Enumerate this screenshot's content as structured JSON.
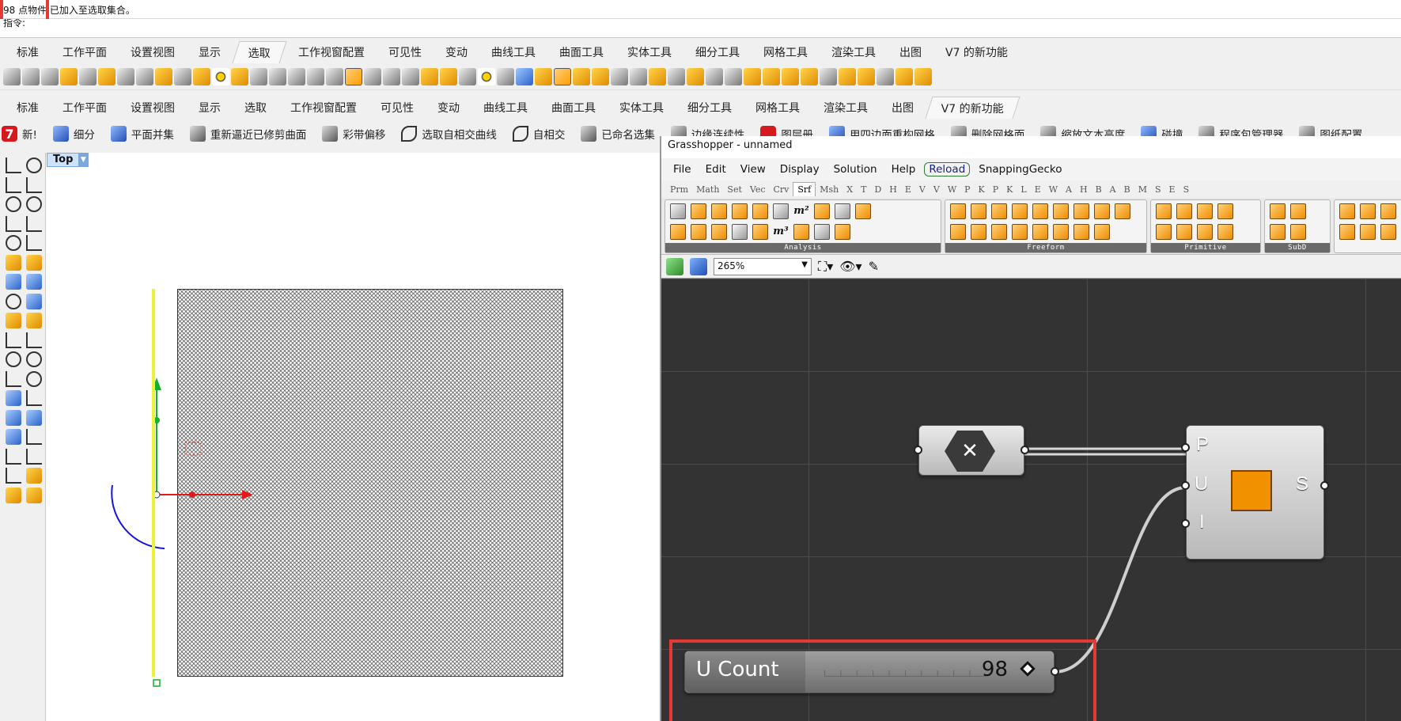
{
  "command": {
    "history_text": "98 点物件 已加入至选取集合。",
    "prompt_text": "指令:"
  },
  "tabs_top": [
    "标准",
    "工作平面",
    "设置视图",
    "显示",
    "选取",
    "工作视窗配置",
    "可见性",
    "变动",
    "曲线工具",
    "曲面工具",
    "实体工具",
    "细分工具",
    "网格工具",
    "渲染工具",
    "出图",
    "V7 的新功能"
  ],
  "tabs_top_active": "选取",
  "tabs_second": [
    "标准",
    "工作平面",
    "设置视图",
    "显示",
    "选取",
    "工作视窗配置",
    "可见性",
    "变动",
    "曲线工具",
    "曲面工具",
    "实体工具",
    "细分工具",
    "网格工具",
    "渲染工具",
    "出图",
    "V7 的新功能"
  ],
  "tabs_second_active": "V7 的新功能",
  "tools": [
    {
      "label": "新!",
      "icon": "new-badge-icon",
      "style": "red"
    },
    {
      "label": "细分",
      "icon": "subd-icon",
      "style": "blue"
    },
    {
      "label": "平面并集",
      "icon": "planar-union-icon",
      "style": "blue"
    },
    {
      "label": "重新逼近已修剪曲面",
      "icon": "refit-trim-icon",
      "style": "grey"
    },
    {
      "label": "彩带偏移",
      "icon": "ribbon-offset-icon",
      "style": "grey"
    },
    {
      "label": "选取自相交曲线",
      "icon": "self-intersect-curve-icon",
      "style": "line"
    },
    {
      "label": "自相交",
      "icon": "self-intersect-icon",
      "style": "line"
    },
    {
      "label": "已命名选集",
      "icon": "named-selection-icon",
      "style": "grey"
    },
    {
      "label": "边缘连续性",
      "icon": "edge-continuity-icon",
      "style": "grey"
    },
    {
      "label": "图层册",
      "icon": "layer-book-icon",
      "style": "red"
    },
    {
      "label": "用四边面重构网格",
      "icon": "quad-remesh-icon",
      "style": "blue"
    },
    {
      "label": "删除网格面",
      "icon": "delete-mesh-faces-icon",
      "style": "grey"
    },
    {
      "label": "缩放文本高度",
      "icon": "scale-text-icon",
      "style": "grey"
    },
    {
      "label": "碰撞",
      "icon": "collision-icon",
      "style": "blue"
    },
    {
      "label": "程序包管理器",
      "icon": "package-manager-icon",
      "style": "grey"
    },
    {
      "label": "图纸配置",
      "icon": "layout-icon",
      "style": "grey"
    }
  ],
  "viewport": {
    "name": "Top"
  },
  "grasshopper": {
    "title": "Grasshopper - unnamed",
    "menu": [
      "File",
      "Edit",
      "View",
      "Display",
      "Solution",
      "Help",
      "Reload",
      "SnappingGecko"
    ],
    "categories": [
      "Prm",
      "Math",
      "Set",
      "Vec",
      "Crv",
      "Srf",
      "Msh",
      "X",
      "T",
      "D",
      "H",
      "E",
      "V",
      "V",
      "W",
      "P",
      "K",
      "P",
      "K",
      "L",
      "E",
      "W",
      "A",
      "H",
      "B",
      "A",
      "B",
      "M",
      "S",
      "E",
      "S"
    ],
    "active_category": "Srf",
    "panels": [
      "Analysis",
      "Freeform",
      "Primitive",
      "SubD"
    ],
    "zoom": "265%",
    "components": {
      "hex_icon": "close-x-icon",
      "surface_ports_in": [
        "P",
        "U",
        "I"
      ],
      "surface_port_out": "S",
      "surface_icon": "plane-surface-icon"
    },
    "slider": {
      "label": "U Count",
      "value": "98"
    }
  },
  "colors": {
    "highlight": "#e53935",
    "canvas": "#333333",
    "accent_orange": "#f29100"
  }
}
